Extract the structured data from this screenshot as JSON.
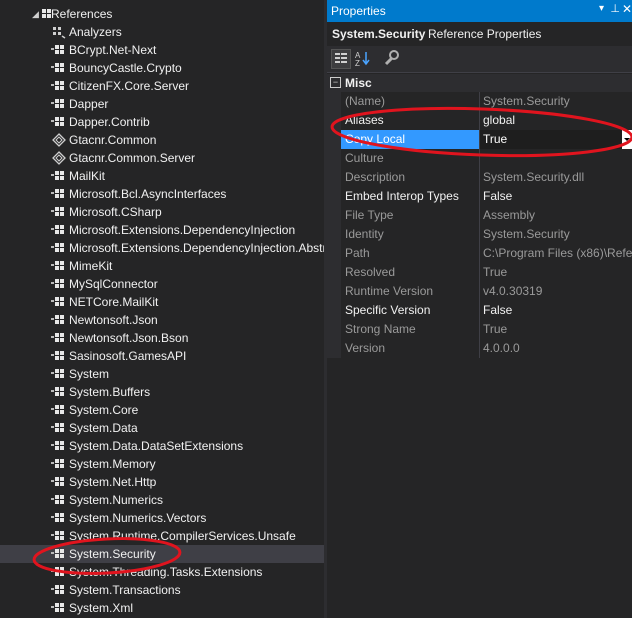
{
  "tree": {
    "root": {
      "label": "References"
    },
    "items": [
      {
        "label": "Analyzers",
        "icon": "analyzers-icon"
      },
      {
        "label": "BCrypt.Net-Next",
        "icon": "reference-icon"
      },
      {
        "label": "BouncyCastle.Crypto",
        "icon": "reference-icon"
      },
      {
        "label": "CitizenFX.Core.Server",
        "icon": "reference-icon"
      },
      {
        "label": "Dapper",
        "icon": "reference-icon"
      },
      {
        "label": "Dapper.Contrib",
        "icon": "reference-icon"
      },
      {
        "label": "Gtacnr.Common",
        "icon": "project-reference-icon"
      },
      {
        "label": "Gtacnr.Common.Server",
        "icon": "project-reference-icon"
      },
      {
        "label": "MailKit",
        "icon": "reference-icon"
      },
      {
        "label": "Microsoft.Bcl.AsyncInterfaces",
        "icon": "reference-icon"
      },
      {
        "label": "Microsoft.CSharp",
        "icon": "reference-icon"
      },
      {
        "label": "Microsoft.Extensions.DependencyInjection",
        "icon": "reference-icon"
      },
      {
        "label": "Microsoft.Extensions.DependencyInjection.Abstr",
        "icon": "reference-icon"
      },
      {
        "label": "MimeKit",
        "icon": "reference-icon"
      },
      {
        "label": "MySqlConnector",
        "icon": "reference-icon"
      },
      {
        "label": "NETCore.MailKit",
        "icon": "reference-icon"
      },
      {
        "label": "Newtonsoft.Json",
        "icon": "reference-icon"
      },
      {
        "label": "Newtonsoft.Json.Bson",
        "icon": "reference-icon"
      },
      {
        "label": "Sasinosoft.GamesAPI",
        "icon": "reference-icon"
      },
      {
        "label": "System",
        "icon": "reference-icon"
      },
      {
        "label": "System.Buffers",
        "icon": "reference-icon"
      },
      {
        "label": "System.Core",
        "icon": "reference-icon"
      },
      {
        "label": "System.Data",
        "icon": "reference-icon"
      },
      {
        "label": "System.Data.DataSetExtensions",
        "icon": "reference-icon"
      },
      {
        "label": "System.Memory",
        "icon": "reference-icon"
      },
      {
        "label": "System.Net.Http",
        "icon": "reference-icon"
      },
      {
        "label": "System.Numerics",
        "icon": "reference-icon"
      },
      {
        "label": "System.Numerics.Vectors",
        "icon": "reference-icon"
      },
      {
        "label": "System.Runtime.CompilerServices.Unsafe",
        "icon": "reference-icon"
      },
      {
        "label": "System.Security",
        "icon": "reference-icon",
        "selected": true
      },
      {
        "label": "System.Threading.Tasks.Extensions",
        "icon": "reference-icon"
      },
      {
        "label": "System.Transactions",
        "icon": "reference-icon"
      },
      {
        "label": "System.Xml",
        "icon": "reference-icon"
      }
    ]
  },
  "properties": {
    "title": "Properties",
    "object_name": "System.Security",
    "object_type": "Reference Properties",
    "category": "Misc",
    "rows": [
      {
        "name": "(Name)",
        "value": "System.Security",
        "name_bright": false,
        "value_bright": false
      },
      {
        "name": "Aliases",
        "value": "global",
        "name_bright": true,
        "value_bright": true
      },
      {
        "name": "Copy Local",
        "value": "True",
        "name_bright": true,
        "value_bright": true,
        "selected": true
      },
      {
        "name": "Culture",
        "value": "",
        "name_bright": false,
        "value_bright": false
      },
      {
        "name": "Description",
        "value": "System.Security.dll",
        "name_bright": false,
        "value_bright": false
      },
      {
        "name": "Embed Interop Types",
        "value": "False",
        "name_bright": true,
        "value_bright": true
      },
      {
        "name": "File Type",
        "value": "Assembly",
        "name_bright": false,
        "value_bright": false
      },
      {
        "name": "Identity",
        "value": "System.Security",
        "name_bright": false,
        "value_bright": false
      },
      {
        "name": "Path",
        "value": "C:\\Program Files (x86)\\Refer",
        "name_bright": false,
        "value_bright": false
      },
      {
        "name": "Resolved",
        "value": "True",
        "name_bright": false,
        "value_bright": false
      },
      {
        "name": "Runtime Version",
        "value": "v4.0.30319",
        "name_bright": false,
        "value_bright": false
      },
      {
        "name": "Specific Version",
        "value": "False",
        "name_bright": true,
        "value_bright": true
      },
      {
        "name": "Strong Name",
        "value": "True",
        "name_bright": false,
        "value_bright": false
      },
      {
        "name": "Version",
        "value": "4.0.0.0",
        "name_bright": false,
        "value_bright": false
      }
    ]
  },
  "colors": {
    "background": "#252526",
    "title_bar": "#007acc",
    "selection": "#3399ff",
    "annotation": "#e0141e"
  }
}
